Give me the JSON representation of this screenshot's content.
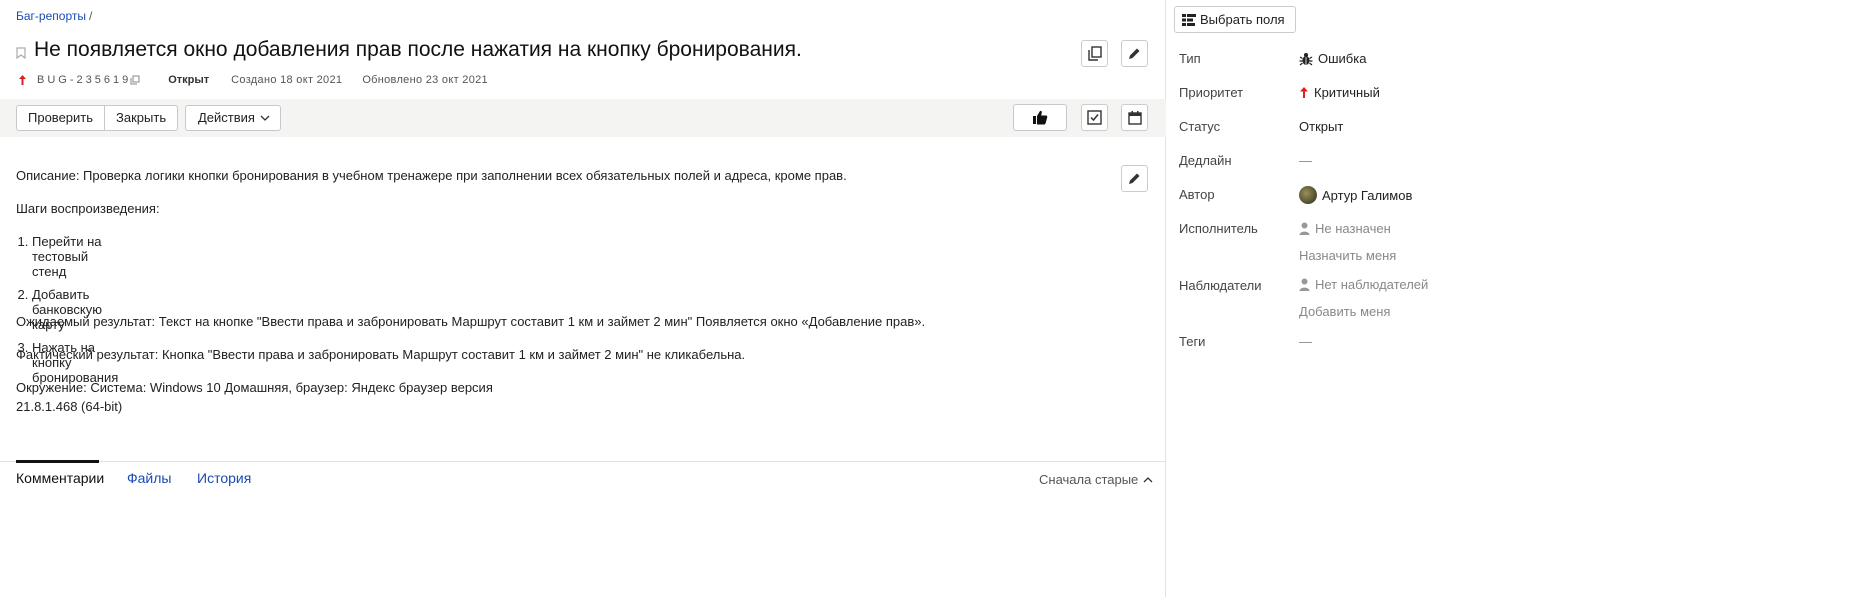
{
  "breadcrumb": {
    "link": "Баг-репорты",
    "separator": "/"
  },
  "issue": {
    "title": "Не появляется окно добавления прав после нажатия на кнопку бронирования.",
    "key": "BUG-235619",
    "status": "Открыт",
    "created": "Создано 18 окт 2021",
    "updated": "Обновлено 23 окт 2021",
    "priority_color": "#e02020"
  },
  "toolbar": {
    "check_label": "Проверить",
    "close_label": "Закрыть",
    "actions_label": "Действия"
  },
  "description": {
    "line1": "Описание: Проверка логики кнопки бронирования в учебном тренажере при заполнении всех обязательных полей и адреса, кроме прав.",
    "steps_title": "Шаги воспроизведения:",
    "steps": [
      "Перейти на тестовый стенд",
      "Добавить банковскую карту",
      "Нажать на кнопку бронирования"
    ],
    "expected": "Ожидаемый результат: Текст на кнопке \"Ввести права и забронировать Маршрут составит 1 км и займет 2 мин\" Появляется окно «Добавление прав».",
    "actual": "Фактический результат: Кнопка \"Ввести права и забронировать Маршрут составит 1 км и займет 2 мин\" не кликабельна.",
    "env_line1": "Окружение: Система: Windows 10 Домашняя, браузер: Яндекс браузер версия",
    "env_line2": "21.8.1.468 (64-bit)"
  },
  "tabs": {
    "comments": "Комментарии",
    "files": "Файлы",
    "history": "История",
    "sort": "Сначала старые"
  },
  "sidebar": {
    "select_fields": "Выбрать поля",
    "type_label": "Тип",
    "type_value": "Ошибка",
    "priority_label": "Приоритет",
    "priority_value": "Критичный",
    "status_label": "Статус",
    "status_value": "Открыт",
    "deadline_label": "Дедлайн",
    "deadline_value": "—",
    "author_label": "Автор",
    "author_value": "Артур Галимов",
    "assignee_label": "Исполнитель",
    "assignee_value": "Не назначен",
    "assign_me": "Назначить меня",
    "watchers_label": "Наблюдатели",
    "watchers_value": "Нет наблюдателей",
    "add_me": "Добавить меня",
    "tags_label": "Теги",
    "tags_value": "—"
  }
}
